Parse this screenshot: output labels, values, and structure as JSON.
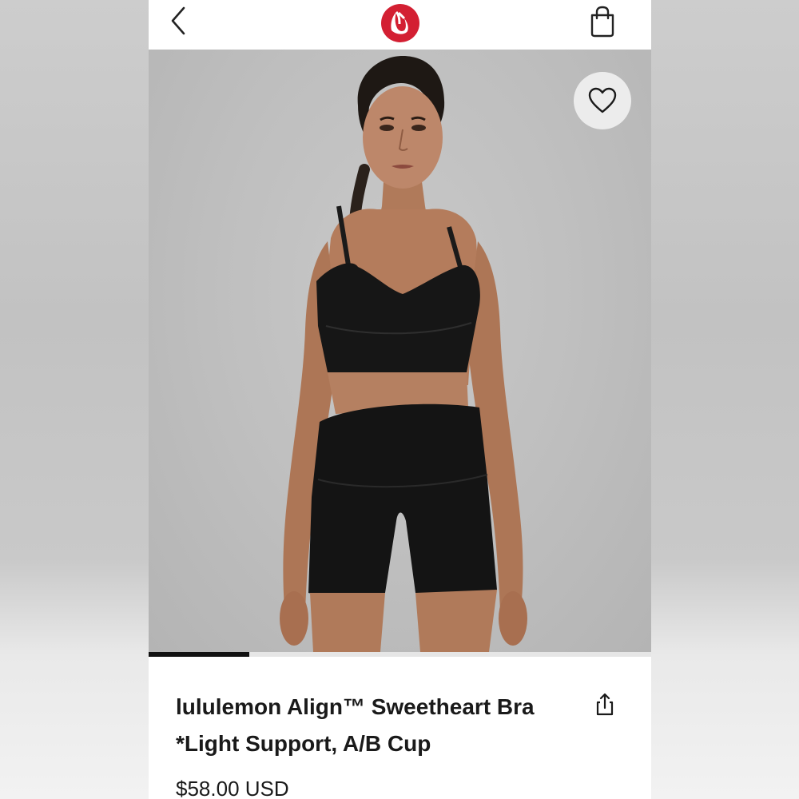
{
  "header": {
    "back_icon": "chevron-left-icon",
    "logo": "lululemon-logo",
    "bag_icon": "shopping-bag-icon",
    "brand_color": "#d31f32"
  },
  "gallery": {
    "favorite_icon": "heart-outline-icon",
    "current_slide_fraction": 0.2,
    "image_subject": "model wearing black sports bra and shorts"
  },
  "product": {
    "title_line1": "lululemon Align™ Sweetheart Bra",
    "title_line2": "*Light Support, A/B Cup",
    "share_icon": "share-icon",
    "price": "$58.00 USD"
  }
}
